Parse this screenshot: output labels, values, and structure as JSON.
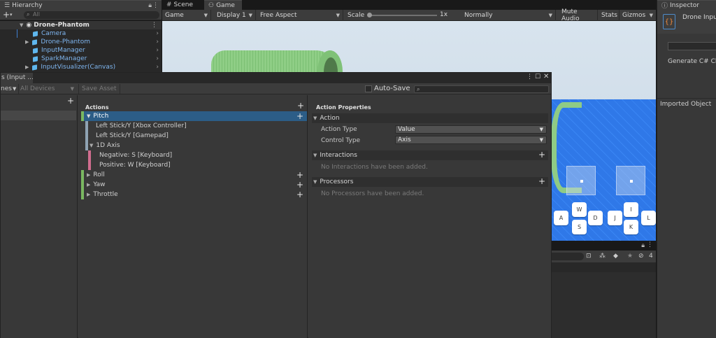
{
  "hierarchy": {
    "tab_label": "Hierarchy",
    "add_label": "+",
    "search_placeholder": "All",
    "scene_name": "Drone-Phantom",
    "items": [
      {
        "label": "Camera"
      },
      {
        "label": "Drone-Phantom"
      },
      {
        "label": "InputManager"
      },
      {
        "label": "SparkManager"
      },
      {
        "label": "InputVisualizer(Canvas)"
      }
    ]
  },
  "game": {
    "tabs": [
      "Scene",
      "Game"
    ],
    "display_mode": "Game",
    "display": "Display 1",
    "aspect": "Free Aspect",
    "scale_label": "Scale",
    "scale_value": "1x",
    "scale_level": 0.0,
    "vsync": "Normally",
    "mute_audio": "Mute Audio",
    "stats": "Stats",
    "gizmos": "Gizmos",
    "keys_left": [
      "W",
      "A",
      "D",
      "S"
    ],
    "keys_right": [
      "I",
      "J",
      "L",
      "K"
    ]
  },
  "inspector": {
    "tab_label": "Inspector",
    "asset_name": "Drone Inpu",
    "generate_label": "Generate C# Cla",
    "imported_label": "Imported Object"
  },
  "input_window": {
    "title": "s (Input ...",
    "schemes_label": "nes",
    "devices_label": "All Devices",
    "save_label": "Save Asset",
    "autosave_label": "Auto-Save",
    "search_value": "",
    "actions_header": "Actions",
    "action_properties_header": "Action Properties",
    "actions": [
      {
        "label": "Pitch",
        "expanded": true,
        "selected": true
      },
      {
        "label": "Left Stick/Y [Xbox Controller]"
      },
      {
        "label": "Left Stick/Y [Gamepad]"
      },
      {
        "label": "1D Axis",
        "expanded": true
      },
      {
        "label": "Negative: S [Keyboard]"
      },
      {
        "label": "Positive: W [Keyboard]"
      },
      {
        "label": "Roll"
      },
      {
        "label": "Yaw"
      },
      {
        "label": "Throttle"
      }
    ],
    "sections": {
      "action": "Action",
      "action_type_label": "Action Type",
      "action_type_value": "Value",
      "control_type_label": "Control Type",
      "control_type_value": "Axis",
      "interactions": "Interactions",
      "interactions_empty": "No Interactions have been added.",
      "processors": "Processors",
      "processors_empty": "No Processors have been added."
    }
  },
  "project_bar": {
    "count": "4"
  },
  "colors": {
    "selection": "#2c5d87",
    "action_stripe": "#7ab861",
    "binding_stripe": "#8fa3b3",
    "composite_stripe": "#d06d8f"
  }
}
